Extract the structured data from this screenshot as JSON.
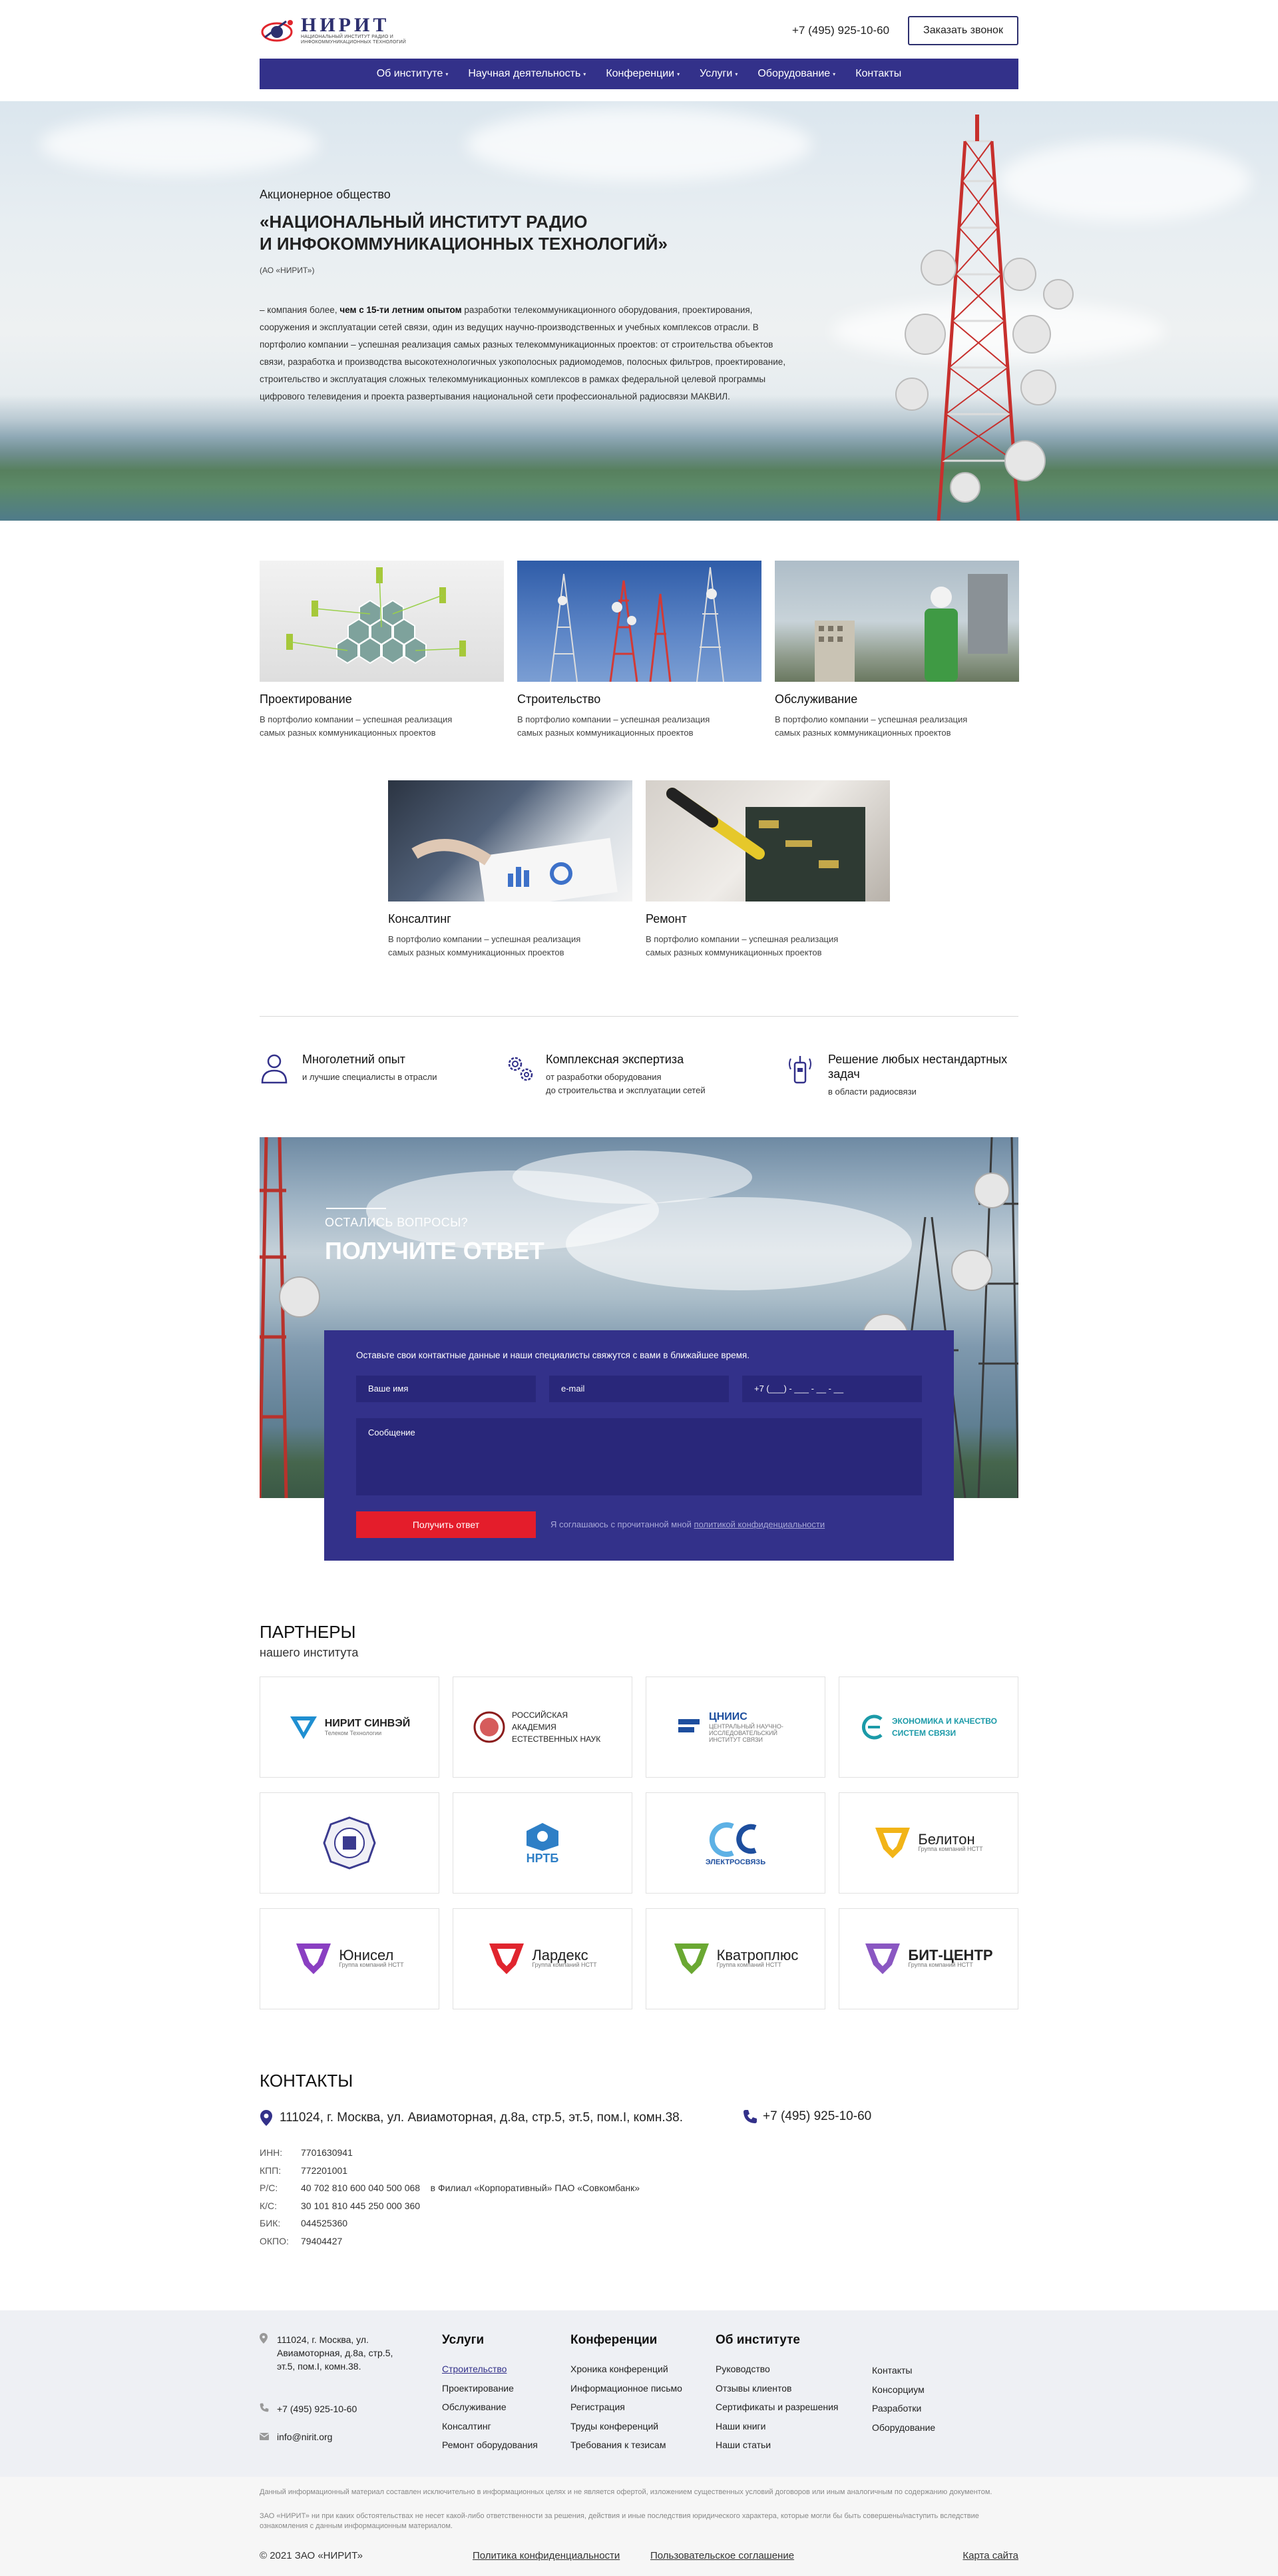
{
  "header": {
    "logo_title": "НИРИТ",
    "logo_subtitle": "НАЦИОНАЛЬНЫЙ ИНСТИТУТ РАДИО И ИНФОКОММУНИКАЦИОННЫХ ТЕХНОЛОГИЙ",
    "phone": "+7 (495) 925-10-60",
    "callback_label": "Заказать звонок"
  },
  "nav": {
    "items": [
      {
        "label": "Об институте",
        "dropdown": true
      },
      {
        "label": "Научная деятельность",
        "dropdown": true
      },
      {
        "label": "Конференции",
        "dropdown": true
      },
      {
        "label": "Услуги",
        "dropdown": true
      },
      {
        "label": "Оборудование",
        "dropdown": true
      },
      {
        "label": "Контакты",
        "dropdown": false
      }
    ]
  },
  "hero": {
    "kicker": "Акционерное общество",
    "title": "«НАЦИОНАЛЬНЫЙ ИНСТИТУТ РАДИО\nИ ИНФОКОММУНИКАЦИОННЫХ ТЕХНОЛОГИЙ»",
    "abbr": "(АО «НИРИТ»)",
    "desc_pre": "– компания более, ",
    "desc_bold": "чем с 15-ти летним опытом",
    "desc_post": " разработки телекоммуникационного оборудования, проектирования, сооружения и эксплуатации сетей связи, один из ведущих научно-производственных и учебных комплексов отрасли. В портфолио компании – успешная реализация самых разных телекоммуникационных проектов: от строительства объектов связи, разработка и производства высокотехнологичных узкополосных радиомодемов, полосных фильтров, проектирование, строительство и эксплуатация сложных телекоммуникационных комплексов в рамках федеральной целевой программы цифрового телевидения и проекта развертывания национальной сети профессиональной радиосвязи МАКВИЛ."
  },
  "services": [
    {
      "title": "Проектирование",
      "text": "В портфолио компании – успешная реализация самых разных коммуникационных проектов"
    },
    {
      "title": "Строительство",
      "text": "В портфолио компании – успешная реализация самых разных коммуникационных проектов"
    },
    {
      "title": "Обслуживание",
      "text": "В портфолио компании – успешная реализация самых разных коммуникационных проектов"
    },
    {
      "title": "Консалтинг",
      "text": "В портфолио компании – успешная реализация самых разных коммуникационных проектов"
    },
    {
      "title": "Ремонт",
      "text": "В портфолио компании – успешная реализация самых разных коммуникационных проектов"
    }
  ],
  "features": [
    {
      "title": "Многолетний опыт",
      "text": "и лучшие специалисты в отрасли",
      "icon": "person-icon"
    },
    {
      "title": "Комплексная экспертиза",
      "text": "от разработки оборудования\nдо строительства и эксплуатации сетей",
      "icon": "gears-icon"
    },
    {
      "title": "Решение любых нестандартных задач",
      "text": "в области радиосвязи",
      "icon": "radio-icon"
    }
  ],
  "question": {
    "kicker": "ОСТАЛИСЬ ВОПРОСЫ?",
    "title": "ПОЛУЧИТЕ ОТВЕТ",
    "note": "Оставьте свои контактные данные и наши специалисты свяжутся с вами в ближайшее время.",
    "name_placeholder": "Ваше имя",
    "email_placeholder": "e-mail",
    "phone_placeholder": "+7 (___) - ___ - __ - __",
    "message_placeholder": "Сообщение",
    "submit_label": "Получить ответ",
    "agree_text": "Я соглашаюсь с прочитанной мной ",
    "agree_link": "политикой конфиденциальности"
  },
  "partners": {
    "title": "ПАРТНЕРЫ",
    "subtitle": "нашего института",
    "items": [
      {
        "name": "НИРИТ СИНВЭЙ",
        "sub": "Телеком Технологии",
        "color": "#1f8fd1",
        "mark": "v"
      },
      {
        "name": "РОССИЙСКАЯ АКАДЕМИЯ ЕСТЕСТВЕННЫХ НАУК",
        "sub": "",
        "color": "#8b1c1c",
        "mark": "seal"
      },
      {
        "name": "ЦНИИС",
        "sub": "ЦЕНТРАЛЬНЫЙ НАУЧНО-ИССЛЕДОВАТЕЛЬСКИЙ ИНСТИТУТ СВЯЗИ",
        "color": "#1d4e9e",
        "mark": "line"
      },
      {
        "name": "ЭКОНОМИКА И КАЧЕСТВО СИСТЕМ СВЯЗИ",
        "sub": "",
        "color": "#1b9aa8",
        "mark": "e"
      },
      {
        "name": "",
        "sub": "",
        "color": "#3b3b8f",
        "mark": "emblem"
      },
      {
        "name": "НРТБ",
        "sub": "",
        "color": "#2e7fc6",
        "mark": "hex"
      },
      {
        "name": "ЭЛЕКТРОСВЯЗЬ",
        "sub": "",
        "color": "#1d4e9e",
        "mark": "es"
      },
      {
        "name": "Белитон",
        "sub": "Группа компаний НСТТ",
        "color": "#f2b417",
        "mark": "v"
      },
      {
        "name": "Юнисел",
        "sub": "Группа компаний НСТТ",
        "color": "#8a3fc2",
        "mark": "v"
      },
      {
        "name": "Лардекс",
        "sub": "Группа компаний НСТТ",
        "color": "#e0252e",
        "mark": "v"
      },
      {
        "name": "Кватроплюс",
        "sub": "Группа компаний НСТТ",
        "color": "#6aa832",
        "mark": "v"
      },
      {
        "name": "БИТ-ЦЕНТР",
        "sub": "Группа компаний НСТТ",
        "color": "#8a57c2",
        "mark": "v"
      }
    ]
  },
  "contacts": {
    "title": "КОНТАКТЫ",
    "address": "111024, г. Москва, ул. Авиамоторная, д.8а, стр.5, эт.5, пом.I, комн.38.",
    "phone": "+7 (495) 925-10-60",
    "requisites": [
      {
        "key": "ИНН:",
        "value": "7701630941",
        "extra": ""
      },
      {
        "key": "КПП:",
        "value": "772201001",
        "extra": ""
      },
      {
        "key": "Р/С:",
        "value": "40 702 810 600 040 500 068",
        "extra": "в Филиал «Корпоративный» ПАО «Совкомбанк»"
      },
      {
        "key": "К/С:",
        "value": "30 101 810 445 250 000 360",
        "extra": ""
      },
      {
        "key": "БИК:",
        "value": "044525360",
        "extra": ""
      },
      {
        "key": "ОКПО:",
        "value": "79404427",
        "extra": ""
      }
    ]
  },
  "footer": {
    "address": "111024, г. Москва, ул. Авиамоторная, д.8а, стр.5, эт.5, пом.I, комн.38.",
    "phone": "+7 (495) 925-10-60",
    "email": "info@nirit.org",
    "col_services": {
      "title": "Услуги",
      "links": [
        "Строительство",
        "Проектирование",
        "Обслуживание",
        "Консалтинг",
        "Ремонт оборудования"
      ]
    },
    "col_conf": {
      "title": "Конференции",
      "links": [
        "Хроника конференций",
        "Информационное письмо",
        "Регистрация",
        "Труды конференций",
        "Требования к тезисам"
      ]
    },
    "col_about": {
      "title": "Об институте",
      "links": [
        "Руководство",
        "Отзывы клиентов",
        "Сертификаты и разрешения",
        "Наши книги",
        "Наши статьи"
      ]
    },
    "col_extra": {
      "links": [
        "Контакты",
        "Консорциум",
        "Разработки",
        "Оборудование"
      ]
    },
    "disclaimer1": "Данный информационный материал составлен исключительно в информационных целях и не является офертой, изложением существенных условий договоров или иным аналогичным по содержанию документом.",
    "disclaimer2": "ЗАО «НИРИТ» ни при каких обстоятельствах не несет какой-либо ответственности за решения, действия и иные последствия юридического характера, которые могли бы быть совершены/наступить вследствие ознакомления с данным информационным материалом.",
    "copyright": "© 2021 ЗАО «НИРИТ»",
    "privacy": "Политика конфиденциальности",
    "agreement": "Пользовательское соглашение",
    "sitemap": "Карта сайта"
  }
}
